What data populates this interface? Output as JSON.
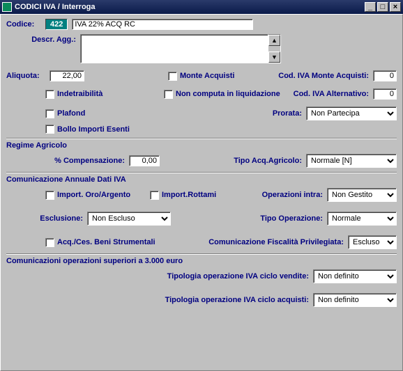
{
  "window": {
    "title": "CODICI IVA / Interroga",
    "controls": {
      "min": "_",
      "max": "□",
      "close": "×"
    }
  },
  "header": {
    "codice_label": "Codice:",
    "codice_value": "422",
    "descr_value": "IVA 22% ACQ RC",
    "descr_agg_label": "Descr. Agg.:",
    "descr_agg_value": ""
  },
  "main": {
    "aliquota_label": "Aliquota:",
    "aliquota_value": "22,00",
    "monte_acq_label": "Monte Acquisti",
    "cod_iva_monte_label": "Cod. IVA Monte Acquisti:",
    "cod_iva_monte_value": "0",
    "indetraibilita_label": "Indetraibilità",
    "non_computa_label": "Non computa in liquidazione",
    "cod_iva_alt_label": "Cod. IVA Alternativo:",
    "cod_iva_alt_value": "0",
    "plafond_label": "Plafond",
    "prorata_label": "Prorata:",
    "prorata_value": "Non Partecipa",
    "bollo_label": "Bollo Importi Esenti"
  },
  "agricolo": {
    "title": "Regime Agricolo",
    "compensazione_label": "% Compensazione:",
    "compensazione_value": "0,00",
    "tipo_acq_label": "Tipo Acq.Agricolo:",
    "tipo_acq_value": "Normale [N]"
  },
  "comunicazione": {
    "title": "Comunicazione Annuale Dati IVA",
    "oro_argento_label": "Import. Oro/Argento",
    "rottami_label": "Import.Rottami",
    "op_intra_label": "Operazioni intra:",
    "op_intra_value": "Non Gestito",
    "esclusione_label": "Esclusione:",
    "esclusione_value": "Non Escluso",
    "tipo_op_label": "Tipo Operazione:",
    "tipo_op_value": "Normale",
    "acq_ces_label": "Acq./Ces. Beni Strumentali",
    "fisc_priv_label": "Comunicazione Fiscalità Privilegiata:",
    "fisc_priv_value": "Escluso"
  },
  "sup3000": {
    "title": "Comunicazioni operazioni superiori a 3.000 euro",
    "vendite_label": "Tipologia operazione IVA ciclo vendite:",
    "vendite_value": "Non definito",
    "acquisti_label": "Tipologia operazione IVA ciclo acquisti:",
    "acquisti_value": "Non definito"
  }
}
